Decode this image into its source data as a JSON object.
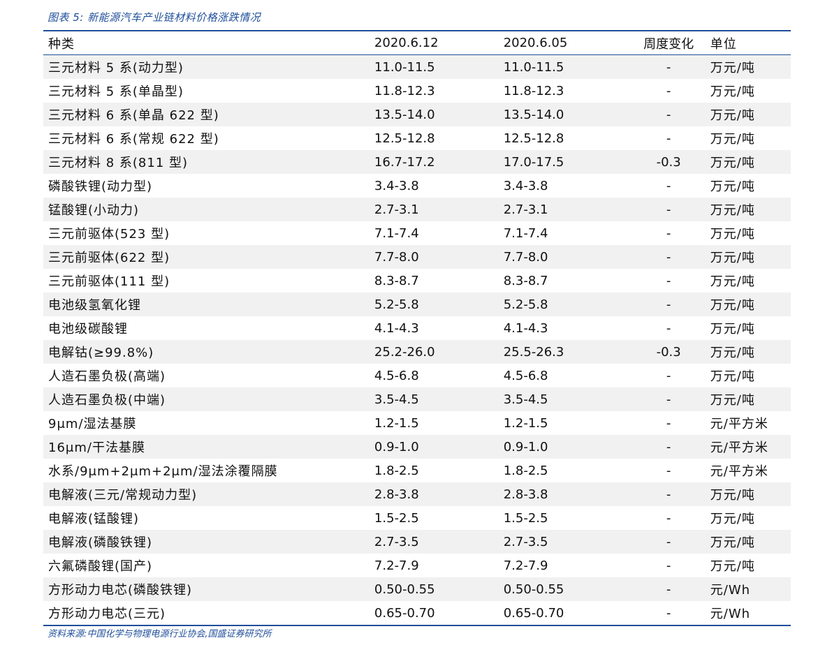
{
  "caption": "图表 5: 新能源汽车产业链材料价格涨跌情况",
  "source": "资料来源:中国化学与物理电源行业协会,国盛证券研究所",
  "table": {
    "headers": [
      "种类",
      "2020.6.12",
      "2020.6.05",
      "周度变化",
      "单位"
    ],
    "rows": [
      [
        "三元材料 5 系(动力型)",
        "11.0-11.5",
        "11.0-11.5",
        "-",
        "万元/吨"
      ],
      [
        "三元材料 5 系(单晶型)",
        "11.8-12.3",
        "11.8-12.3",
        "-",
        "万元/吨"
      ],
      [
        "三元材料 6 系(单晶 622 型)",
        "13.5-14.0",
        "13.5-14.0",
        "-",
        "万元/吨"
      ],
      [
        "三元材料 6 系(常规 622 型)",
        "12.5-12.8",
        "12.5-12.8",
        "-",
        "万元/吨"
      ],
      [
        "三元材料 8 系(811 型)",
        "16.7-17.2",
        "17.0-17.5",
        "-0.3",
        "万元/吨"
      ],
      [
        "磷酸铁锂(动力型)",
        "3.4-3.8",
        "3.4-3.8",
        "-",
        "万元/吨"
      ],
      [
        "锰酸锂(小动力)",
        "2.7-3.1",
        "2.7-3.1",
        "-",
        "万元/吨"
      ],
      [
        "三元前驱体(523 型)",
        "7.1-7.4",
        "7.1-7.4",
        "-",
        "万元/吨"
      ],
      [
        "三元前驱体(622 型)",
        "7.7-8.0",
        "7.7-8.0",
        "-",
        "万元/吨"
      ],
      [
        "三元前驱体(111 型)",
        "8.3-8.7",
        "8.3-8.7",
        "-",
        "万元/吨"
      ],
      [
        "电池级氢氧化锂",
        "5.2-5.8",
        "5.2-5.8",
        "-",
        "万元/吨"
      ],
      [
        "电池级碳酸锂",
        "4.1-4.3",
        "4.1-4.3",
        "-",
        "万元/吨"
      ],
      [
        "电解钴(≥99.8%)",
        "25.2-26.0",
        "25.5-26.3",
        "-0.3",
        "万元/吨"
      ],
      [
        "人造石墨负极(高端)",
        "4.5-6.8",
        "4.5-6.8",
        "-",
        "万元/吨"
      ],
      [
        "人造石墨负极(中端)",
        "3.5-4.5",
        "3.5-4.5",
        "-",
        "万元/吨"
      ],
      [
        "9μm/湿法基膜",
        "1.2-1.5",
        "1.2-1.5",
        "-",
        "元/平方米"
      ],
      [
        "16μm/干法基膜",
        "0.9-1.0",
        "0.9-1.0",
        "-",
        "元/平方米"
      ],
      [
        "水系/9μm+2μm+2μm/湿法涂覆隔膜",
        "1.8-2.5",
        "1.8-2.5",
        "-",
        "元/平方米"
      ],
      [
        "电解液(三元/常规动力型)",
        "2.8-3.8",
        "2.8-3.8",
        "-",
        "万元/吨"
      ],
      [
        "电解液(锰酸锂)",
        "1.5-2.5",
        "1.5-2.5",
        "-",
        "万元/吨"
      ],
      [
        "电解液(磷酸铁锂)",
        "2.7-3.5",
        "2.7-3.5",
        "-",
        "万元/吨"
      ],
      [
        "六氟磷酸锂(国产)",
        "7.2-7.9",
        "7.2-7.9",
        "-",
        "万元/吨"
      ],
      [
        "方形动力电芯(磷酸铁锂)",
        "0.50-0.55",
        "0.50-0.55",
        "-",
        "元/Wh"
      ],
      [
        "方形动力电芯(三元)",
        "0.65-0.70",
        "0.65-0.70",
        "-",
        "元/Wh"
      ]
    ]
  }
}
